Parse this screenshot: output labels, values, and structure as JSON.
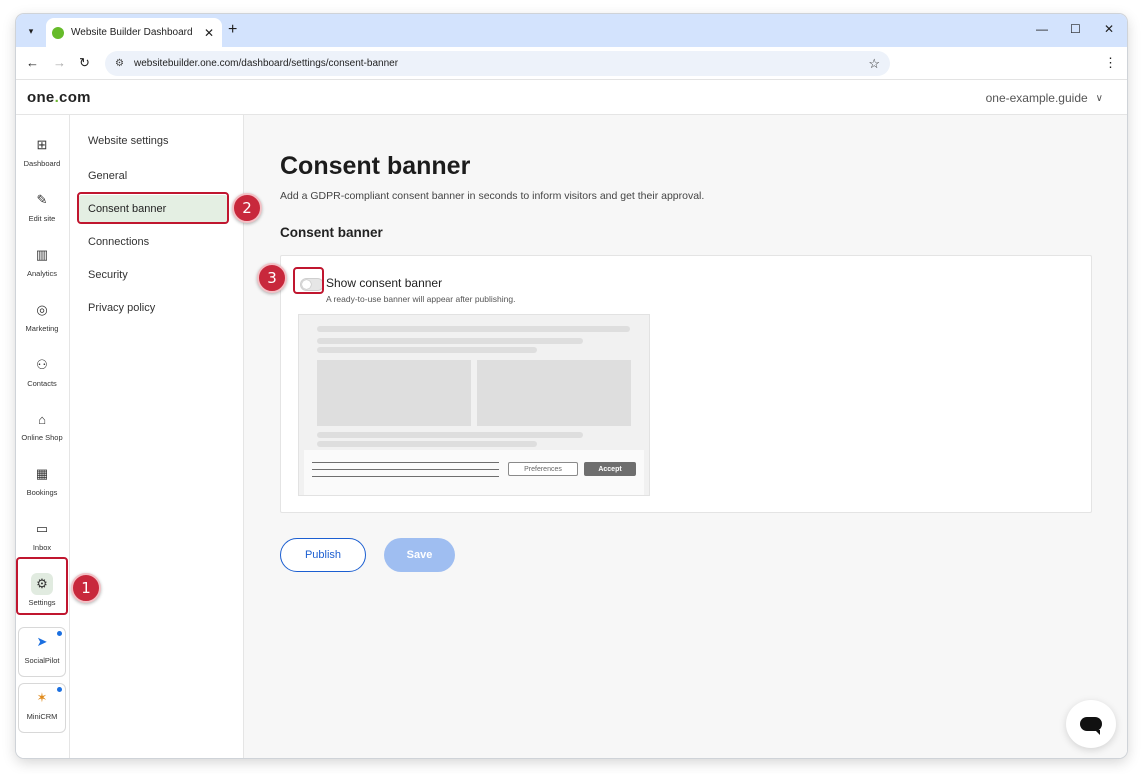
{
  "browser": {
    "tab_title": "Website Builder Dashboard",
    "url": "websitebuilder.one.com/dashboard/settings/consent-banner",
    "icons": {
      "tab_menu": "▾",
      "tab_close": "✕",
      "new_tab": "+",
      "minimize": "—",
      "maximize": "☐",
      "close": "✕",
      "back": "←",
      "forward": "→",
      "reload": "↻",
      "site_info": "⚙",
      "bookmark": "☆",
      "menu": "⋮"
    }
  },
  "app": {
    "logo_prefix": "one",
    "logo_dot": ".",
    "logo_suffix": "com",
    "site_name": "one-example.guide",
    "site_chevron": "∨"
  },
  "rail": {
    "items": [
      {
        "label": "Dashboard",
        "icon": "⊞"
      },
      {
        "label": "Edit site",
        "icon": "✎"
      },
      {
        "label": "Analytics",
        "icon": "▥"
      },
      {
        "label": "Marketing",
        "icon": "◎"
      },
      {
        "label": "Contacts",
        "icon": "⚇"
      },
      {
        "label": "Online Shop",
        "icon": "⌂"
      },
      {
        "label": "Bookings",
        "icon": "▦"
      },
      {
        "label": "Inbox",
        "icon": "▭"
      },
      {
        "label": "Settings",
        "icon": "⚙"
      }
    ],
    "apps": [
      {
        "label": "SocialPilot",
        "icon": "➤"
      },
      {
        "label": "MiniCRM",
        "icon": "✶"
      }
    ]
  },
  "submenu": {
    "title": "Website settings",
    "items": [
      {
        "label": "General"
      },
      {
        "label": "Consent banner"
      },
      {
        "label": "Connections"
      },
      {
        "label": "Security"
      },
      {
        "label": "Privacy policy"
      }
    ],
    "active": "Consent banner"
  },
  "main": {
    "title": "Consent banner",
    "description": "Add a GDPR-compliant consent banner in seconds to inform visitors and get their approval.",
    "section_title": "Consent banner",
    "toggle_label": "Show consent banner",
    "toggle_help": "A ready-to-use banner will appear after publishing.",
    "toggle_on": false,
    "preview": {
      "preferences_label": "Preferences",
      "accept_label": "Accept"
    },
    "publish_label": "Publish",
    "save_label": "Save"
  },
  "callouts": [
    "1",
    "2",
    "3"
  ],
  "colors": {
    "accent_blue": "#1c5fd1",
    "active_green": "#e4efe3",
    "callout_red": "#c8283c"
  }
}
